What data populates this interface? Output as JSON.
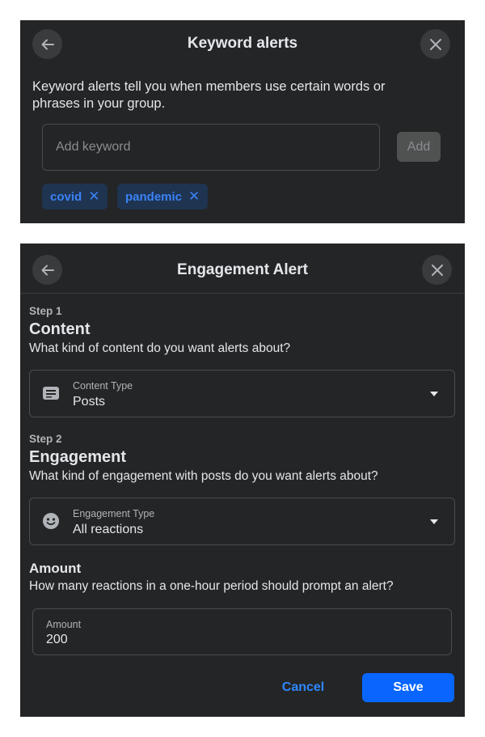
{
  "keyword_alerts": {
    "title": "Keyword alerts",
    "description": "Keyword alerts tell you when members use certain words or phrases in your group.",
    "input_placeholder": "Add keyword",
    "add_label": "Add",
    "chips": [
      {
        "label": "covid"
      },
      {
        "label": "pandemic"
      }
    ],
    "chip_remove_glyph": "✕"
  },
  "engagement_alert": {
    "title": "Engagement Alert",
    "step1": {
      "label": "Step 1",
      "title": "Content",
      "description": "What kind of content do you want alerts about?",
      "select_label": "Content Type",
      "select_value": "Posts",
      "icon": "post-icon"
    },
    "step2": {
      "label": "Step 2",
      "title": "Engagement",
      "description": "What kind of engagement with posts do you want alerts about?",
      "select_label": "Engagement Type",
      "select_value": "All reactions",
      "icon": "smiley-icon"
    },
    "amount": {
      "title": "Amount",
      "description": "How many reactions in a one-hour period should prompt an alert?",
      "field_label": "Amount",
      "field_value": "200"
    },
    "cancel_label": "Cancel",
    "save_label": "Save"
  },
  "colors": {
    "panel_bg": "#242526",
    "accent": "#0866ff",
    "chip_bg": "#1e3450",
    "chip_text": "#3b82f6"
  }
}
